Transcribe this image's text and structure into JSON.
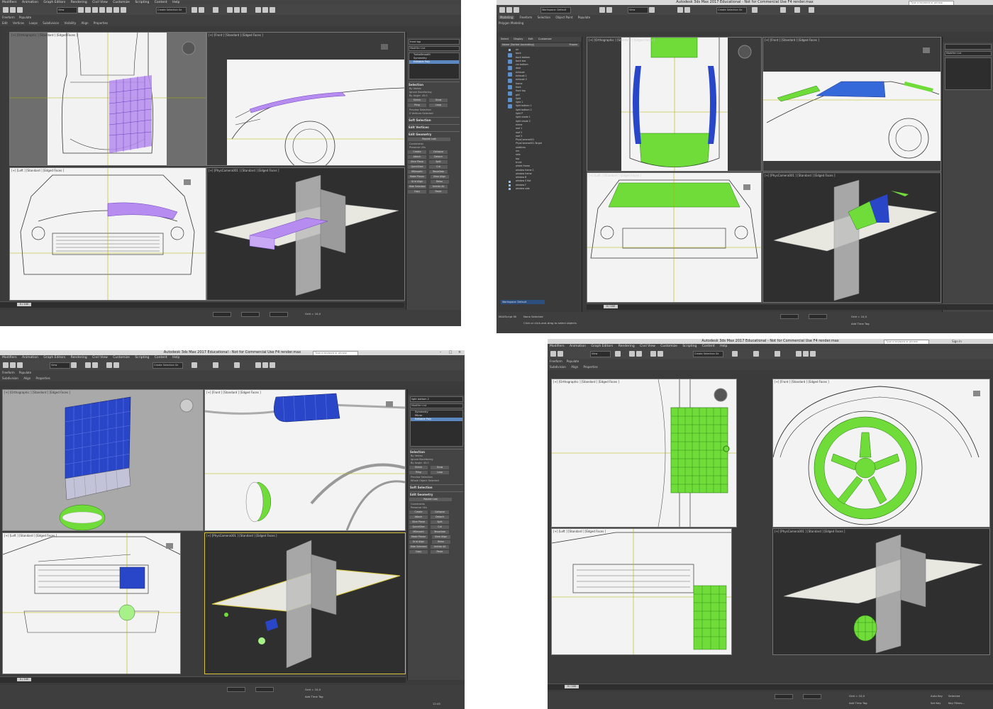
{
  "app": {
    "title_prefix": "Autodesk 3ds Max 2017 Educational",
    "title_suffix": "- Not for Commercial Use",
    "file": "F4 render.max",
    "search_placeholder": "Type a keyword or phrase",
    "sign_in": "Sign In"
  },
  "menu": [
    "Modifiers",
    "Animation",
    "Graph Editors",
    "Rendering",
    "Civil View",
    "Customize",
    "Scripting",
    "Content",
    "Help"
  ],
  "toolbar": {
    "filter": "View",
    "selection_set": "Create Selection Se"
  },
  "ribbon_tabs": [
    "Modeling",
    "Freeform",
    "Selection",
    "Object Paint",
    "Populate"
  ],
  "ribbon_subtabs": [
    "Polygon Modeling",
    "Subdivision",
    "Align",
    "Properties"
  ],
  "ribbon_subtabs_tl": [
    "Edit",
    "Vertices",
    "Loops",
    "Subdivision",
    "Visibility",
    "Align",
    "Properties"
  ],
  "panels": [
    {
      "id": "top_left",
      "viewports": [
        {
          "label": "[+] [Orthographic ] [Standard ] [Edged Faces ]"
        },
        {
          "label": "[+] [Front ] [Standard ] [Edged Faces ]"
        },
        {
          "label": "[+] [Left ] [Standard ] [Edged Faces ]"
        },
        {
          "label": "[+] [PhysCamera001 ] [Standard ] [Edged Faces ]"
        }
      ],
      "object_name": "front top",
      "modifier_list": "Modifier List",
      "stack": [
        "TurboSmooth",
        "Symmetry",
        "Editable Poly"
      ],
      "stack_selected": 2,
      "rollouts": [
        "Selection",
        "Soft Selection",
        "Edit Vertices",
        "Edit Geometry"
      ],
      "selection_info": "0 Vertices Selected",
      "frame": "0 / 100"
    },
    {
      "id": "top_right",
      "workspace": "Workspace: Default",
      "scene_tabs": [
        "Select",
        "Display",
        "Edit",
        "Customize"
      ],
      "scene_header": "Name (Sorted Ascending)",
      "frozen": "Frozen",
      "scene_items": [
        "air",
        "back",
        "back bottom",
        "back box",
        "car bottom",
        "door",
        "exhaust",
        "exhaust 1",
        "exhaust 2",
        "frame",
        "front",
        "front top",
        "grill",
        "light",
        "light 1",
        "light bottom 1",
        "light bottom 2",
        "light P",
        "light shade 1",
        "light shade 2",
        "mirror",
        "roof 1",
        "roof 2",
        "roof 3",
        "PhysCamera001",
        "PhysCamera001.Target",
        "sidelines",
        "rim",
        "side",
        "top",
        "trunk",
        "wheel frame",
        "window frame 1",
        "window frame",
        "window B",
        "window S flat",
        "window F",
        "window side"
      ],
      "viewports": [
        {
          "label": "[+] [Orthographic ] [Standard ] [Edged Faces ]"
        },
        {
          "label": "[+] [Front ] [Standard ] [Edged Faces ]"
        },
        {
          "label": "[+] [Left ] [Standard ] [Edged Faces ]"
        },
        {
          "label": "[+] [PhysCamera001 ] [Standard ] [Edged Faces ]"
        }
      ],
      "modifier_list": "Modifier List",
      "status_1": "None Selected",
      "status_2": "Click or click-and-drag to select objects",
      "maxscript": "MAXScript Mi",
      "frame": "0 / 100",
      "grid": "Grid = 10,0",
      "add_time_tag": "Add Time Tag"
    },
    {
      "id": "bottom_left",
      "viewports": [
        {
          "label": "[+] [Orthographic ] [Standard ] [Edged Faces ]"
        },
        {
          "label": "[+] [Front ] [Standard ] [Edged Faces ]"
        },
        {
          "label": "[+] [Left ] [Standard ] [Edged Faces ]"
        },
        {
          "label": "[+] [PhysCamera001 ] [Standard ] [Edged Faces ]"
        }
      ],
      "object_name": "light bottom 2",
      "modifier_list": "Modifier List",
      "stack": [
        "Symmetry",
        "Mirror",
        "Editable Poly"
      ],
      "stack_selected": 2,
      "rollouts": [
        "Selection",
        "Soft Selection",
        "Edit Geometry"
      ],
      "selection_info": "Whole Object Selected",
      "frame": "0 / 100",
      "grid": "Grid = 10,0",
      "add_time_tag": "Add Time Tag",
      "clock": "12:45"
    },
    {
      "id": "bottom_right",
      "viewports": [
        {
          "label": "[+] [Orthographic ] [Standard ] [Edged Faces ]"
        },
        {
          "label": "[+] [Front ] [Standard ] [Edged Faces ]"
        },
        {
          "label": "[+] [Left ] [Standard ] [Edged Faces ]"
        },
        {
          "label": "[+] [PhysCamera001 ] [Standard ] [Edged Faces ]"
        }
      ],
      "frame": "0 / 100",
      "grid": "Grid = 10,0",
      "add_time_tag": "Add Time Tag",
      "auto_key": "Auto Key",
      "set_key": "Set Key",
      "selected": "Selected",
      "key_filters": "Key Filters..."
    }
  ],
  "buttons": {
    "shrink": "Shrink",
    "grow": "Grow",
    "ring": "Ring",
    "loop": "Loop",
    "repeat_last": "Repeat Last",
    "create": "Create",
    "collapse": "Collapse",
    "attach": "Attach",
    "detach": "Detach",
    "slice_plane": "Slice Plane",
    "split": "Split",
    "quickslice": "QuickSlice",
    "cut": "Cut",
    "msmooth": "MSmooth",
    "tessellate": "Tessellate",
    "make_planar": "Make Planar",
    "view_align": "View Align",
    "grid_align": "Grid Align",
    "relax": "Relax",
    "hide_selected": "Hide Selected",
    "unhide_all": "Unhide All",
    "copy": "Copy",
    "paste": "Paste"
  },
  "constraints": {
    "title": "Constraints",
    "none": "None",
    "edge": "Edge",
    "face": "Face",
    "normal": "Normal",
    "preserve_uvs": "Preserve UVs"
  },
  "preview": {
    "title": "Preview Selection",
    "off": "Off",
    "subobj": "SubObj",
    "multi": "Multi"
  },
  "selection_opts": [
    "By Vertex",
    "Ignore Backfacing",
    "By Angle: 45.0"
  ],
  "colors": {
    "purple": "#b68cf0",
    "green": "#6fdc3a",
    "blue": "#2a46c8",
    "active_border": "#d6c53a"
  }
}
